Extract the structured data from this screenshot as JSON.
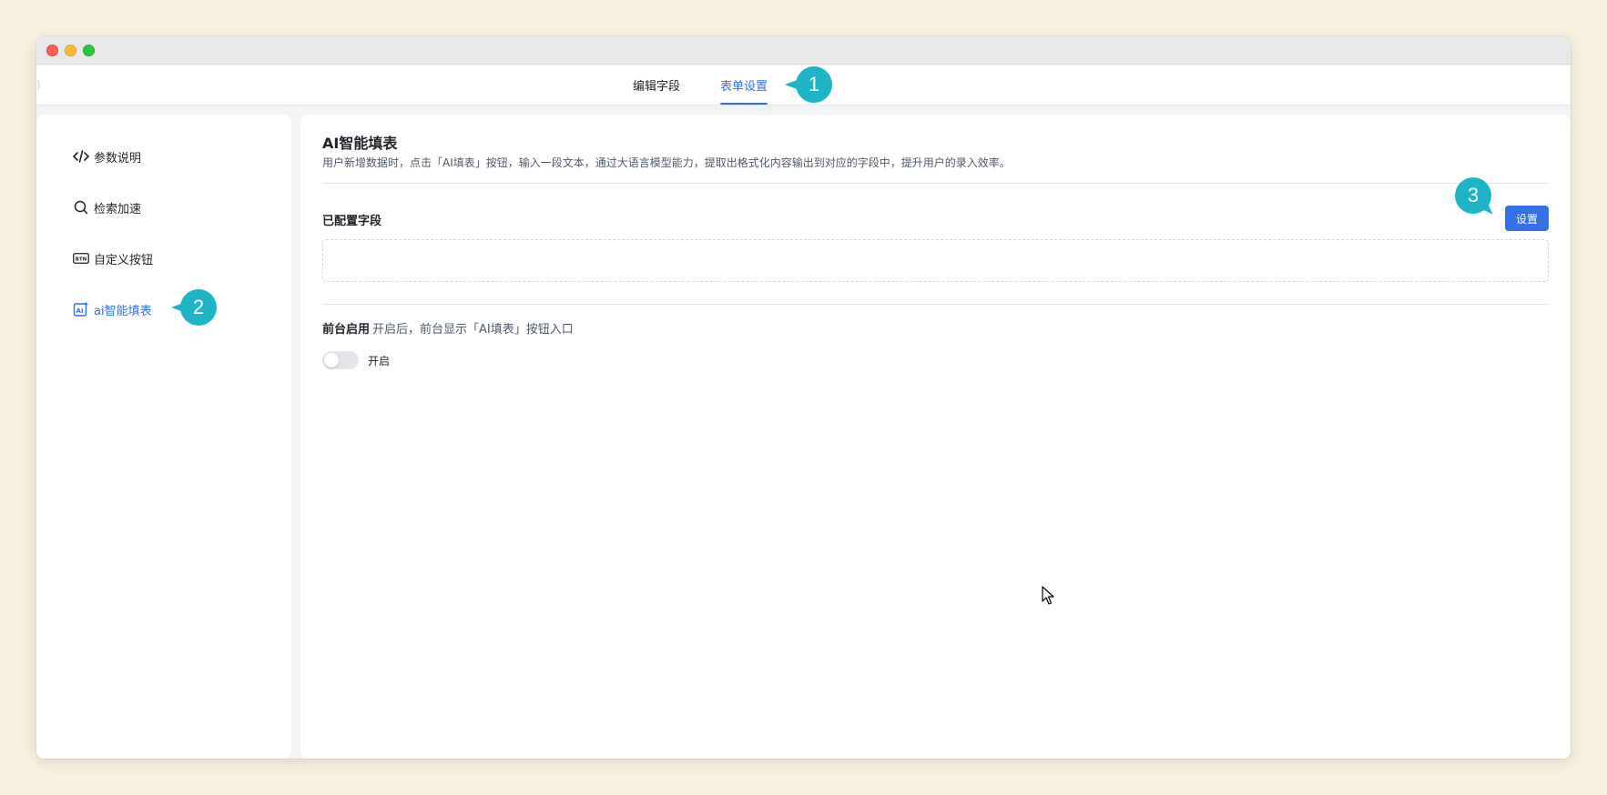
{
  "window": {
    "controls": [
      "close",
      "minimize",
      "maximize"
    ]
  },
  "topnav": {
    "tabs": [
      {
        "label": "编辑字段",
        "active": false
      },
      {
        "label": "表单设置",
        "active": true
      }
    ]
  },
  "sidebar": {
    "items": [
      {
        "label": "参数说明",
        "icon": "code-icon",
        "active": false
      },
      {
        "label": "检索加速",
        "icon": "search-icon",
        "active": false
      },
      {
        "label": "自定义按钮",
        "icon": "btn-icon",
        "active": false
      },
      {
        "label": "ai智能填表",
        "icon": "ai-form-icon",
        "active": true
      }
    ]
  },
  "main": {
    "title": "AI智能填表",
    "description": "用户新增数据时，点击「AI填表」按钮，输入一段文本，通过大语言模型能力，提取出格式化内容输出到对应的字段中，提升用户的录入效率。",
    "configured_fields_label": "已配置字段",
    "settings_button": "设置",
    "front_enable_label": "前台启用",
    "front_enable_hint": "开启后，前台显示「AI填表」按钮入口",
    "toggle_label": "开启",
    "toggle_on": false
  },
  "annotations": {
    "badge1": "1",
    "badge2": "2",
    "badge3": "3",
    "color": "#1fb5c9"
  },
  "colors": {
    "accent": "#3370e8",
    "background": "#f8efde"
  }
}
